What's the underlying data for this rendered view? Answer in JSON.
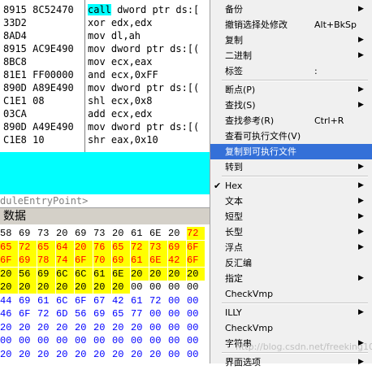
{
  "disasm": {
    "rows": [
      {
        "hex": "8915 8C52470",
        "ins": "call dword ptr ds:[",
        "call": true
      },
      {
        "hex": "33D2",
        "ins": "xor edx,edx"
      },
      {
        "hex": "8AD4",
        "ins": "mov dl,ah"
      },
      {
        "hex": "8915 AC9E490",
        "ins": "mov dword ptr ds:[("
      },
      {
        "hex": "8BC8",
        "ins": "mov ecx,eax"
      },
      {
        "hex": "81E1 FF00000",
        "ins": "and ecx,0xFF"
      },
      {
        "hex": "890D A89E490",
        "ins": "mov dword ptr ds:[("
      },
      {
        "hex": "C1E1 08",
        "ins": "shl ecx,0x8"
      },
      {
        "hex": "03CA",
        "ins": "add ecx,edx"
      },
      {
        "hex": "890D A49E490",
        "ins": "mov dword ptr ds:[("
      },
      {
        "hex": "C1E8 10",
        "ins": "shr eax,0x10"
      }
    ],
    "call_word": "call",
    "call_rest": " dword ptr ds:["
  },
  "entry_label": "duleEntryPoint>",
  "dump_title": "数据",
  "dump_rows": [
    [
      "58",
      "69",
      "73",
      "20",
      "69",
      "73",
      "20",
      "61",
      "6E",
      "20",
      "72"
    ],
    [
      "65",
      "72",
      "65",
      "64",
      "20",
      "76",
      "65",
      "72",
      "73",
      "69",
      "6F"
    ],
    [
      "6F",
      "69",
      "78",
      "74",
      "6F",
      "70",
      "69",
      "61",
      "6E",
      "42",
      "6F"
    ],
    [
      "20",
      "56",
      "69",
      "6C",
      "6C",
      "61",
      "6E",
      "20",
      "20",
      "20",
      "20"
    ],
    [
      "20",
      "20",
      "20",
      "20",
      "20",
      "20",
      "20",
      "00",
      "00",
      "00",
      "00"
    ],
    [
      "44",
      "69",
      "61",
      "6C",
      "6F",
      "67",
      "42",
      "61",
      "72",
      "00",
      "00"
    ],
    [
      "46",
      "6F",
      "72",
      "6D",
      "56",
      "69",
      "65",
      "77",
      "00",
      "00",
      "00"
    ],
    [
      "20",
      "20",
      "20",
      "20",
      "20",
      "20",
      "20",
      "20",
      "00",
      "00",
      "00"
    ],
    [
      "00",
      "00",
      "00",
      "00",
      "00",
      "00",
      "00",
      "00",
      "00",
      "00",
      "00"
    ],
    [
      "20",
      "20",
      "20",
      "20",
      "20",
      "20",
      "20",
      "20",
      "20",
      "00",
      "00"
    ]
  ],
  "menu": {
    "items": [
      {
        "label": "备份",
        "arrow": true
      },
      {
        "label": "撤销选择处修改",
        "shortcut": "Alt+BkSp"
      },
      {
        "label": "复制",
        "arrow": true
      },
      {
        "label": "二进制",
        "arrow": true
      },
      {
        "label": "标签",
        "shortcut": ":"
      },
      {
        "label": "断点(P)",
        "arrow": true
      },
      {
        "label": "查找(S)",
        "arrow": true
      },
      {
        "label": "查找参考(R)",
        "shortcut": "Ctrl+R"
      },
      {
        "label": "查看可执行文件(V)"
      },
      {
        "label": "复制到可执行文件",
        "selected": true
      },
      {
        "label": "转到",
        "arrow": true
      },
      {
        "label": "Hex",
        "checked": true,
        "arrow": true
      },
      {
        "label": "文本",
        "arrow": true
      },
      {
        "label": "短型",
        "arrow": true
      },
      {
        "label": "长型",
        "arrow": true
      },
      {
        "label": "浮点",
        "arrow": true
      },
      {
        "label": "反汇编"
      },
      {
        "label": "指定",
        "arrow": true
      },
      {
        "label": "CheckVmp"
      },
      {
        "label": "ILLY",
        "arrow": true
      },
      {
        "label": "CheckVmp"
      },
      {
        "label": "字符串",
        "arrow": true
      },
      {
        "label": "界面选项",
        "arrow": true
      }
    ]
  },
  "watermark": "http://blog.csdn.net/freeking101",
  "colors": {
    "selection": "#3470d8",
    "cyan": "#00ffff",
    "highlight_yellow": "#ffff00"
  }
}
